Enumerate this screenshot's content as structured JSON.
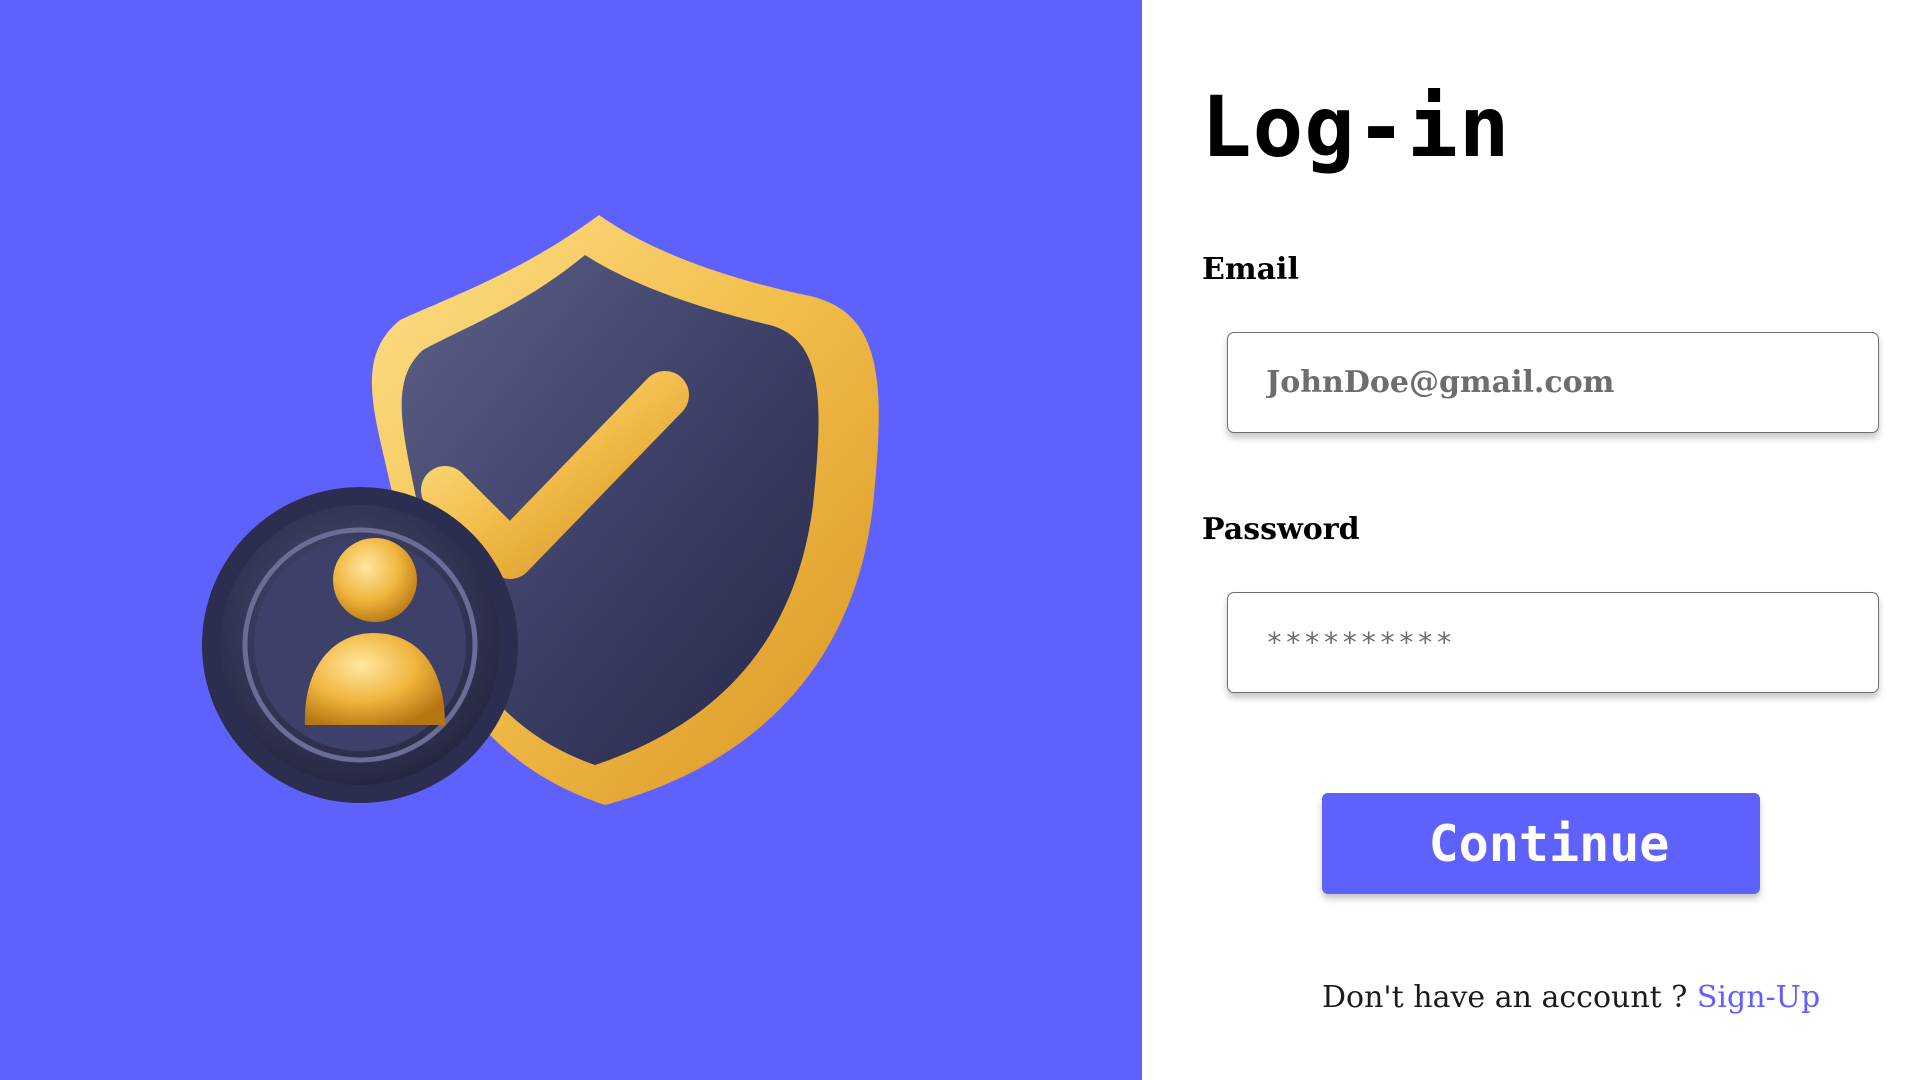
{
  "hero": {
    "illustration": "shield-check-user-icon",
    "background_color": "#5f61fc",
    "accent_gold": "#f3c04f",
    "shield_navy": "#3d3f66"
  },
  "form": {
    "title": "Log-in",
    "email": {
      "label": "Email",
      "placeholder": "JohnDoe@gmail.com",
      "value": ""
    },
    "password": {
      "label": "Password",
      "placeholder": "**********",
      "value": ""
    },
    "continue_label": "Continue",
    "signup_prompt": "Don't have an account ? ",
    "signup_link": "Sign-Up",
    "accent_color": "#5f61fc"
  }
}
